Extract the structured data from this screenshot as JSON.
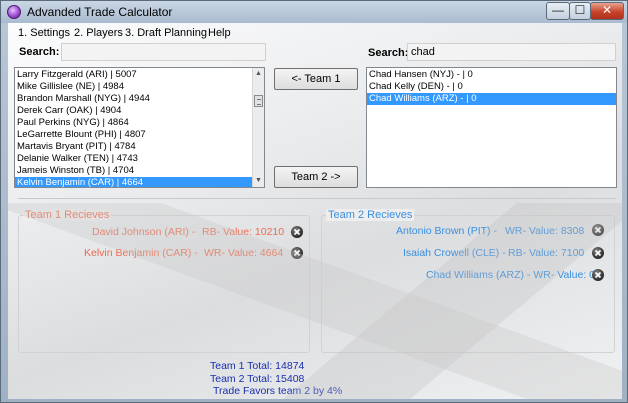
{
  "window": {
    "title": "Advanded Trade Calculator",
    "controls": {
      "minimize": "—",
      "maximize": "☐",
      "close": "✕"
    }
  },
  "menu": [
    "1. Settings",
    "2. Players",
    "3. Draft Planning",
    "Help"
  ],
  "left_panel": {
    "search_label": "Search:",
    "search_value": "",
    "players": [
      "Larry Fitzgerald (ARI) | 5007",
      "Mike Gillislee (NE) | 4984",
      "Brandon Marshall (NYG) | 4944",
      "Derek Carr (OAK) | 4904",
      "Paul Perkins (NYG) | 4864",
      "LeGarrette Blount (PHI) | 4807",
      "Martavis Bryant (PIT) | 4784",
      "Delanie Walker (TEN) | 4743",
      "Jameis Winston (TB) | 4704",
      "Kelvin Benjamin (CAR) | 4664"
    ],
    "selected_index": 9
  },
  "right_panel": {
    "search_label": "Search:",
    "search_value": "chad",
    "players": [
      "Chad Hansen (NYJ) - | 0",
      "Chad Kelly (DEN) - | 0",
      "Chad Williams (ARZ) - | 0"
    ],
    "selected_index": 2
  },
  "buttons": {
    "to_team1": "<- Team 1",
    "to_team2": "Team 2 ->"
  },
  "team1": {
    "title": "Team 1 Recieves",
    "color": "#f06a4b",
    "entries": [
      {
        "name": "David Johnson (ARI) -",
        "value": "RB- Value: 10210"
      },
      {
        "name": "Kelvin Benjamin (CAR) -",
        "value": "WR- Value: 4664"
      }
    ]
  },
  "team2": {
    "title": "Team 2 Recieves",
    "color": "#3a8fe0",
    "entries": [
      {
        "name": "Antonio Brown (PIT) -",
        "value": "WR- Value: 8308"
      },
      {
        "name": "Isaiah Crowell (CLE) -",
        "value": "RB- Value: 7100"
      },
      {
        "name": "Chad Williams (ARZ) - WR- Value: 0",
        "value": ""
      }
    ]
  },
  "totals": {
    "team1": "Team 1 Total: 14874",
    "team2": "Team 2 Total: 15408",
    "verdict": "Trade Favors team 2 by 4%"
  },
  "icons": {
    "app": "app-orb-icon",
    "remove": "close-circle-icon"
  }
}
